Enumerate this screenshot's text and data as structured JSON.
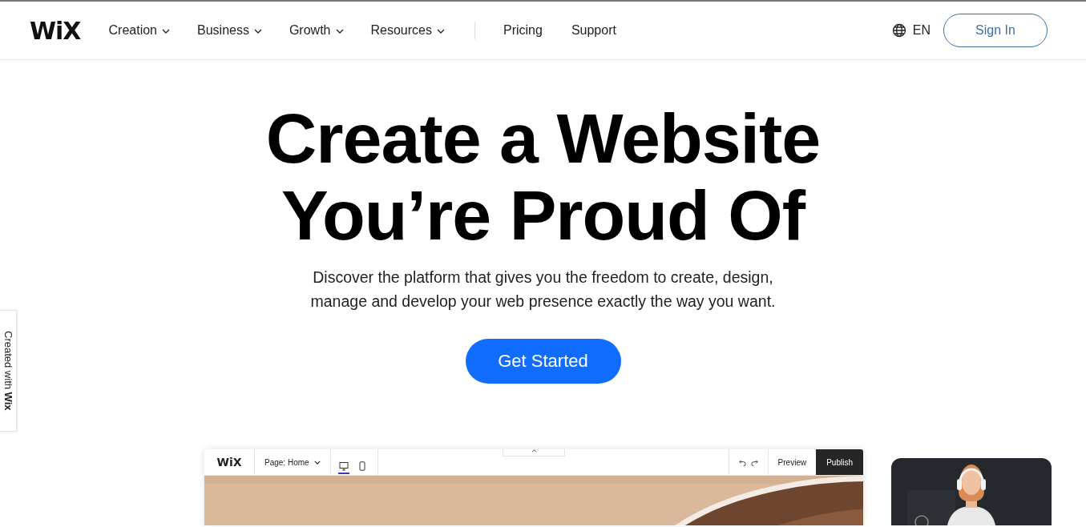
{
  "nav": {
    "logo": "WiX",
    "menus": [
      {
        "label": "Creation"
      },
      {
        "label": "Business"
      },
      {
        "label": "Growth"
      },
      {
        "label": "Resources"
      }
    ],
    "links": [
      {
        "label": "Pricing"
      },
      {
        "label": "Support"
      }
    ],
    "language": "EN",
    "sign_in": "Sign In"
  },
  "side_badge": "Created with **Wix**",
  "hero": {
    "title_lines": [
      "Create a Website",
      "You’re Proud Of"
    ],
    "subtitle_lines": [
      "Discover the platform that gives you the freedom to create, design,",
      "manage and develop your web presence exactly the way you want."
    ],
    "cta": "Get Started"
  },
  "editor_mockup": {
    "logo": "WiX",
    "page_select": "Page: Home",
    "devices": [
      {
        "kind": "desktop",
        "selected": true
      },
      {
        "kind": "mobile",
        "selected": false
      }
    ],
    "preview": "Preview",
    "publish": "Publish"
  }
}
